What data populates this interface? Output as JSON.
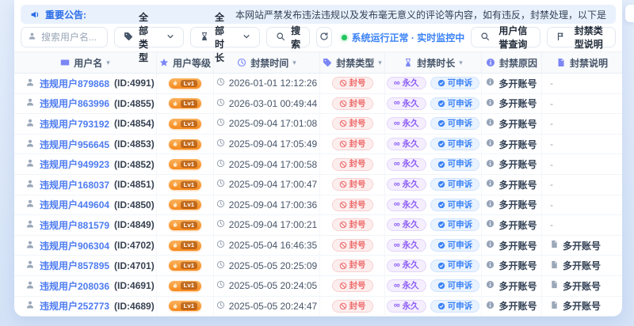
{
  "announcement": {
    "label": "重要公告:",
    "text": "本网站严禁发布违法违规以及发布毫无意义的评论等内容，如有违反，封禁处理，以下是"
  },
  "toolbar": {
    "search_placeholder": "搜索用户名...",
    "type_filter": "全部类型",
    "duration_filter": "全部时长",
    "search_button": "搜索",
    "status": "系统运行正常 · 实时监控中",
    "reputation_button": "用户信誉查询",
    "type_help_button": "封禁类型说明"
  },
  "table": {
    "headers": [
      {
        "key": "username",
        "label": "用户名",
        "icon": "id-card-icon",
        "sortable": true
      },
      {
        "key": "level",
        "label": "用户等级",
        "icon": "star-icon",
        "sortable": false
      },
      {
        "key": "ban-time",
        "label": "封禁时间",
        "icon": "clock-icon",
        "sortable": true
      },
      {
        "key": "ban-type",
        "label": "封禁类型",
        "icon": "tag-icon",
        "sortable": true
      },
      {
        "key": "ban-duration",
        "label": "封禁时长",
        "icon": "hourglass-icon",
        "sortable": true
      },
      {
        "key": "ban-reason",
        "label": "封禁原因",
        "icon": "info-icon",
        "sortable": false
      },
      {
        "key": "ban-note",
        "label": "封禁说明",
        "icon": "document-icon",
        "sortable": false
      }
    ],
    "level_label": "Lv1",
    "ban_type_label": "封号",
    "duration_label": "永久",
    "appeal_label": "可申诉",
    "reason_label": "多开账号",
    "rows": [
      {
        "username": "违规用户879868",
        "user_id": "(ID:4991)",
        "time": "2026-01-01 12:12:26",
        "note": "-"
      },
      {
        "username": "违规用户863996",
        "user_id": "(ID:4855)",
        "time": "2026-03-01 00:49:44",
        "note": "-"
      },
      {
        "username": "违规用户793192",
        "user_id": "(ID:4854)",
        "time": "2025-09-04 17:01:08",
        "note": "-"
      },
      {
        "username": "违规用户956645",
        "user_id": "(ID:4853)",
        "time": "2025-09-04 17:05:49",
        "note": "-"
      },
      {
        "username": "违规用户949923",
        "user_id": "(ID:4852)",
        "time": "2025-09-04 17:00:58",
        "note": "-"
      },
      {
        "username": "违规用户168037",
        "user_id": "(ID:4851)",
        "time": "2025-09-04 17:00:47",
        "note": "-"
      },
      {
        "username": "违规用户449604",
        "user_id": "(ID:4850)",
        "time": "2025-09-04 17:00:36",
        "note": "-"
      },
      {
        "username": "违规用户881579",
        "user_id": "(ID:4849)",
        "time": "2025-09-04 17:00:21",
        "note": "-"
      },
      {
        "username": "违规用户906304",
        "user_id": "(ID:4702)",
        "time": "2025-05-04 16:46:35",
        "note": "多开账号"
      },
      {
        "username": "违规用户857895",
        "user_id": "(ID:4701)",
        "time": "2025-05-05 20:25:09",
        "note": "多开账号"
      },
      {
        "username": "违规用户208036",
        "user_id": "(ID:4691)",
        "time": "2025-05-05 20:24:05",
        "note": "多开账号"
      },
      {
        "username": "违规用户252773",
        "user_id": "(ID:4689)",
        "time": "2025-05-05 20:24:47",
        "note": "多开账号"
      }
    ]
  },
  "colors": {
    "link": "#4e7cf0",
    "danger": "#ee6b6b",
    "purple": "#8b5cf6",
    "blue": "#3b82f6",
    "green": "#22c55e",
    "orange": "#f6891e"
  }
}
